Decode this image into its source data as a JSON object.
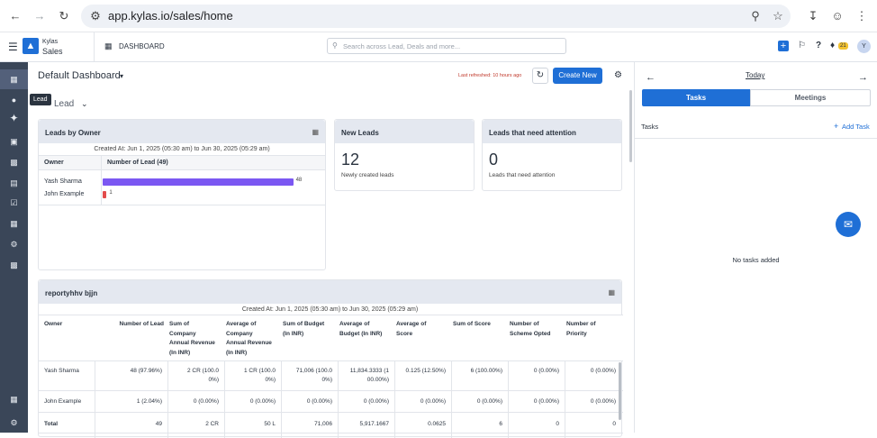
{
  "browser": {
    "url": "app.kylas.io/sales/home",
    "icons": [
      "back-arrow-icon",
      "forward-arrow-icon",
      "reload-icon",
      "site-settings-icon",
      "zoom-icon",
      "bookmark-star-icon",
      "download-icon",
      "profile-icon",
      "menu-dots-icon"
    ]
  },
  "app": {
    "brand_top": "Kylas",
    "brand_bottom": "Sales",
    "section": "DASHBOARD",
    "search_placeholder": "Search across Lead, Deals and more...",
    "notification_count": "21",
    "avatar_initial": "Y",
    "accent": "#1f6fd6"
  },
  "sidebar": {
    "tooltip": "Lead",
    "items": [
      "dashboard-icon",
      "lead-icon",
      "contact-icon",
      "company-icon",
      "document-icon",
      "task-icon",
      "calendar-icon",
      "settings-gear-icon",
      "report-icon",
      "apps-icon",
      "gear-icon"
    ]
  },
  "dashboard": {
    "title": "Default Dashboard",
    "last_refreshed": "Last refreshed: 10 hours ago",
    "create_new": "Create New",
    "entity_select": "Lead"
  },
  "leads_by_owner": {
    "title": "Leads by Owner",
    "created_at": "Created At: Jun 1, 2025 (05:30 am) to Jun 30, 2025 (05:29 am)",
    "col_owner": "Owner",
    "col_count": "Number of Lead (49)",
    "rows": [
      {
        "owner": "Yash Sharma",
        "value": 48,
        "label": "48",
        "color": "#7b57f2"
      },
      {
        "owner": "John Example",
        "value": 1,
        "label": "1",
        "color": "#e24c4c"
      }
    ],
    "max": 49
  },
  "new_leads": {
    "title": "New Leads",
    "value": "12",
    "caption": "Newly created leads"
  },
  "attention_leads": {
    "title": "Leads that need attention",
    "value": "0",
    "caption": "Leads that need attention"
  },
  "report": {
    "title": "reportyhhv bjjn",
    "created_at": "Created At: Jun 1, 2025 (05:30 am) to Jun 30, 2025 (05:29 am)",
    "headers": [
      [
        "Owner"
      ],
      [
        "Number of Lead"
      ],
      [
        "Sum of",
        "Company",
        "Annual Revenue",
        "(In INR)"
      ],
      [
        "Average of",
        "Company",
        "Annual Revenue",
        "(In INR)"
      ],
      [
        "Sum of Budget",
        "(In INR)"
      ],
      [
        "Average of",
        "Budget (In INR)"
      ],
      [
        "Average of",
        "Score"
      ],
      [
        "Sum of Score"
      ],
      [
        "Number of",
        "Scheme Opted"
      ],
      [
        "Number of",
        "Priority"
      ]
    ],
    "rows": [
      [
        "Yash Sharma",
        "48 (97.96%)",
        "2 CR (100.0|0%)",
        "1 CR (100.0|0%)",
        "71,006 (100.0|0%)",
        "11,834.3333 (1|00.00%)",
        "0.125 (12.50%)",
        "6 (100.00%)",
        "0 (0.00%)",
        "0 (0.00%)"
      ],
      [
        "John Example",
        "1 (2.04%)",
        "0 (0.00%)",
        "0 (0.00%)",
        "0 (0.00%)",
        "0 (0.00%)",
        "0 (0.00%)",
        "0 (0.00%)",
        "0 (0.00%)",
        "0 (0.00%)"
      ],
      [
        "Total",
        "49",
        "2 CR",
        "50 L",
        "71,006",
        "5,917.1667",
        "0.0625",
        "6",
        "0",
        "0"
      ]
    ]
  },
  "right_panel": {
    "date_label": "Today",
    "tab_tasks": "Tasks",
    "tab_meetings": "Meetings",
    "section_label": "Tasks",
    "add_task": "Add Task",
    "empty": "No tasks added"
  }
}
